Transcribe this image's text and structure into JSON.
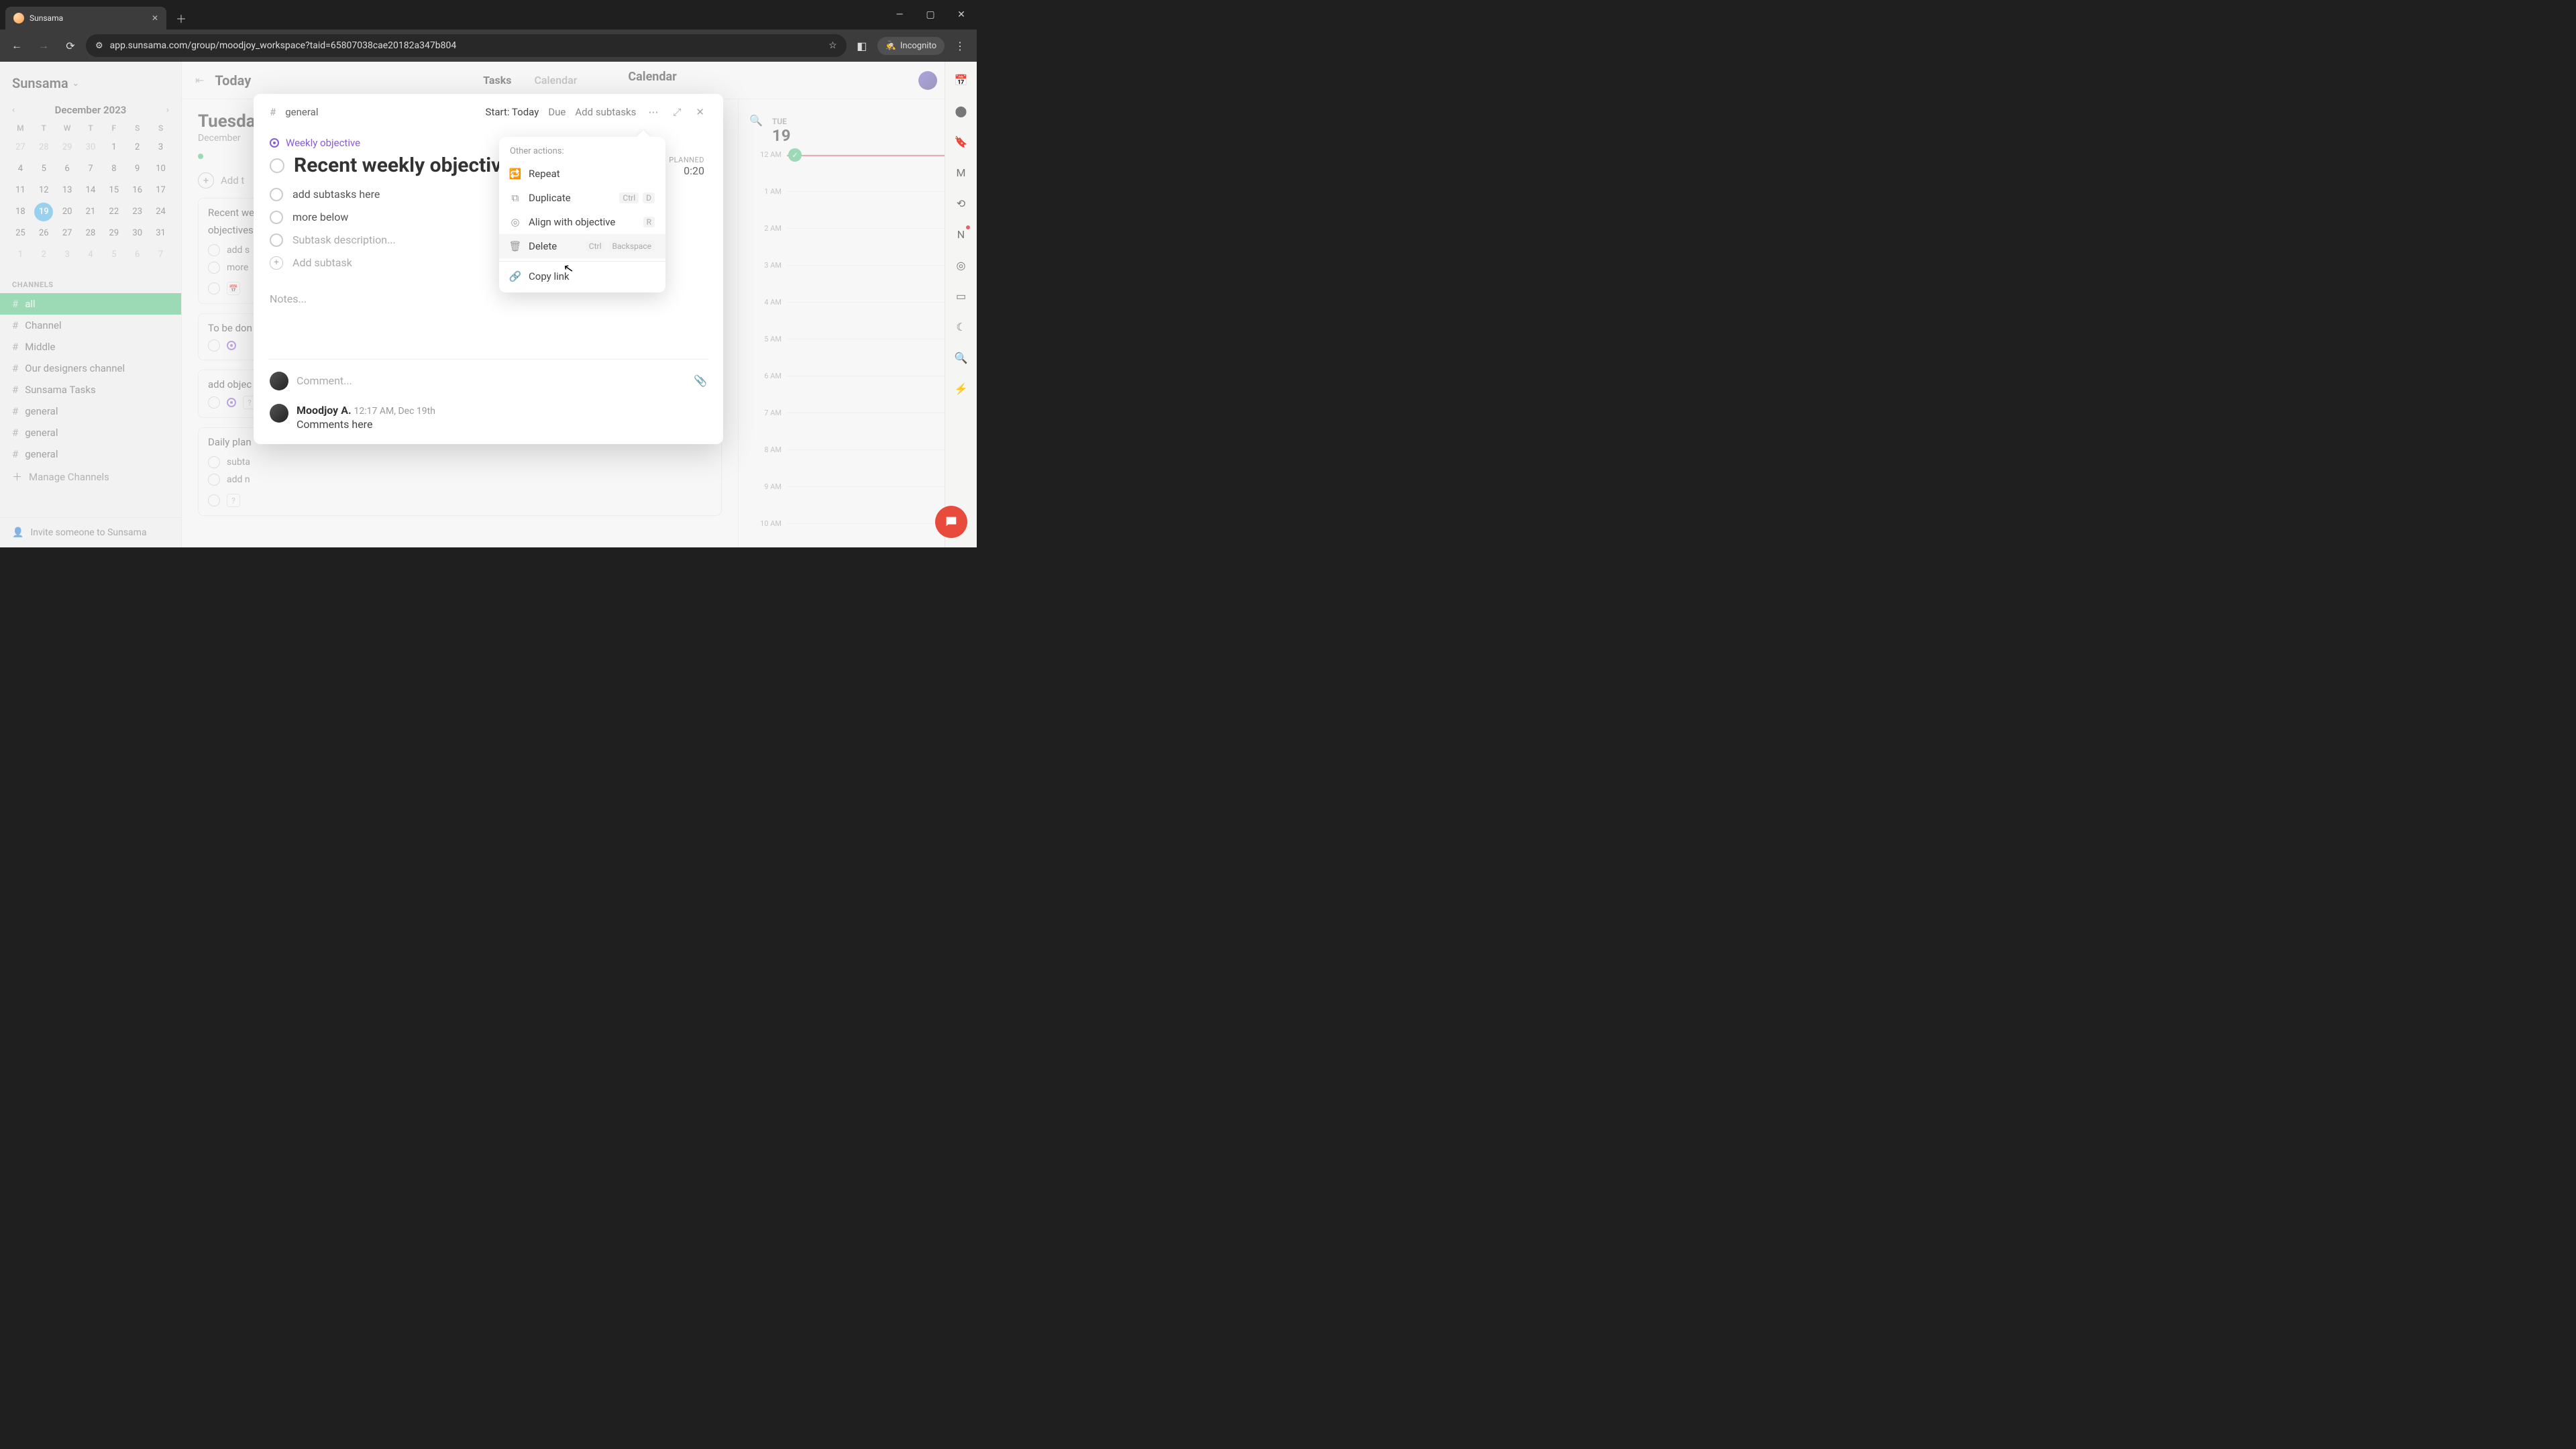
{
  "browser": {
    "tab_title": "Sunsama",
    "url": "app.sunsama.com/group/moodjoy_workspace?taid=65807038cae20182a347b804",
    "incognito_label": "Incognito"
  },
  "workspace": {
    "name": "Sunsama"
  },
  "minical": {
    "month": "December 2023",
    "dows": [
      "M",
      "T",
      "W",
      "T",
      "F",
      "S",
      "S"
    ],
    "weeks": [
      [
        {
          "d": "27",
          "o": true
        },
        {
          "d": "28",
          "o": true
        },
        {
          "d": "29",
          "o": true
        },
        {
          "d": "30",
          "o": true
        },
        {
          "d": "1"
        },
        {
          "d": "2"
        },
        {
          "d": "3"
        }
      ],
      [
        {
          "d": "4"
        },
        {
          "d": "5"
        },
        {
          "d": "6"
        },
        {
          "d": "7"
        },
        {
          "d": "8"
        },
        {
          "d": "9"
        },
        {
          "d": "10"
        }
      ],
      [
        {
          "d": "11"
        },
        {
          "d": "12"
        },
        {
          "d": "13"
        },
        {
          "d": "14"
        },
        {
          "d": "15"
        },
        {
          "d": "16"
        },
        {
          "d": "17"
        }
      ],
      [
        {
          "d": "18"
        },
        {
          "d": "19",
          "today": true
        },
        {
          "d": "20"
        },
        {
          "d": "21"
        },
        {
          "d": "22"
        },
        {
          "d": "23"
        },
        {
          "d": "24"
        }
      ],
      [
        {
          "d": "25"
        },
        {
          "d": "26"
        },
        {
          "d": "27"
        },
        {
          "d": "28"
        },
        {
          "d": "29"
        },
        {
          "d": "30"
        },
        {
          "d": "31"
        }
      ],
      [
        {
          "d": "1",
          "o": true
        },
        {
          "d": "2",
          "o": true
        },
        {
          "d": "3",
          "o": true
        },
        {
          "d": "4",
          "o": true
        },
        {
          "d": "5",
          "o": true
        },
        {
          "d": "6",
          "o": true
        },
        {
          "d": "7",
          "o": true
        }
      ]
    ]
  },
  "channels": {
    "header": "CHANNELS",
    "items": [
      "all",
      "Channel",
      "Middle",
      "Our designers channel",
      "Sunsama Tasks",
      "general",
      "general",
      "general"
    ],
    "manage": "Manage Channels",
    "invite": "Invite someone to Sunsama"
  },
  "header": {
    "today": "Today",
    "tabs": {
      "tasks": "Tasks",
      "calendar": "Calendar"
    }
  },
  "day": {
    "title": "Tuesda",
    "subtitle": "December",
    "add_task": "Add t",
    "cards": [
      {
        "title_a": "Recent we",
        "title_b": "objectives",
        "subs": [
          "add s",
          "more"
        ]
      },
      {
        "title": "To be don"
      },
      {
        "title": "add objec"
      },
      {
        "title": "Daily plan",
        "subs": [
          "subta",
          "add n"
        ]
      }
    ]
  },
  "calendar": {
    "title": "Calendar",
    "dow": "TUE",
    "date": "19",
    "hours": [
      "12 AM",
      "1 AM",
      "2 AM",
      "3 AM",
      "4 AM",
      "5 AM",
      "6 AM",
      "7 AM",
      "8 AM",
      "9 AM",
      "10 AM"
    ]
  },
  "modal": {
    "channel": "general",
    "start": "Start: Today",
    "due": "Due",
    "add_subtasks": "Add subtasks",
    "weekly_label": "Weekly objective",
    "title": "Recent weekly objective here:",
    "planned_label": "PLANNED",
    "planned_value": "0:20",
    "subs": [
      "add subtasks here",
      "more below"
    ],
    "sub_placeholder": "Subtask description...",
    "add_sub": "Add subtask",
    "notes_placeholder": "Notes...",
    "comment_placeholder": "Comment...",
    "author": "Moodjoy A.",
    "posted_time": "12:17 AM, Dec 19th",
    "posted_body": "Comments here"
  },
  "dropdown": {
    "header": "Other actions:",
    "items": [
      {
        "label": "Repeat"
      },
      {
        "label": "Duplicate",
        "shortcut": [
          "Ctrl",
          "D"
        ]
      },
      {
        "label": "Align with objective",
        "shortcut": [
          "R"
        ]
      },
      {
        "label": "Delete",
        "shortcut": [
          "Ctrl",
          "Backspace"
        ]
      }
    ],
    "copy": "Copy link"
  }
}
